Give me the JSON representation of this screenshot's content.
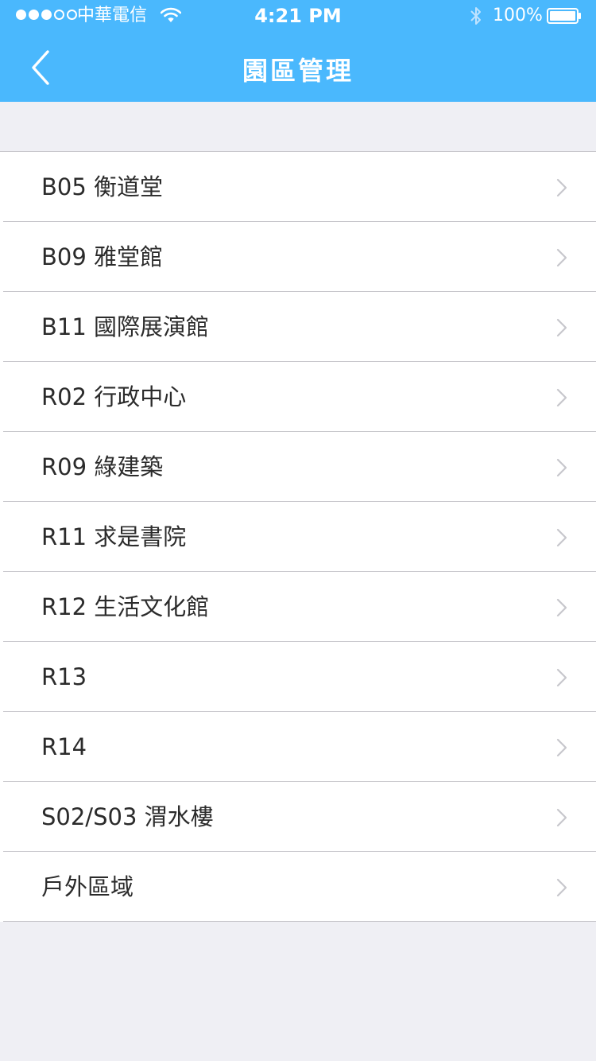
{
  "status_bar": {
    "carrier": "中華電信",
    "time": "4:21 PM",
    "battery": "100%",
    "signal_bars_filled": 3,
    "signal_bars_total": 5,
    "icons": [
      "wifi-icon",
      "bluetooth-icon",
      "battery-icon"
    ]
  },
  "nav": {
    "title": "園區管理",
    "back_icon": "chevron-left-icon"
  },
  "list": {
    "items": [
      {
        "label": "B05 衡道堂"
      },
      {
        "label": "B09 雅堂館"
      },
      {
        "label": "B11 國際展演館"
      },
      {
        "label": "R02 行政中心"
      },
      {
        "label": "R09 綠建築"
      },
      {
        "label": "R11 求是書院"
      },
      {
        "label": "R12 生活文化館"
      },
      {
        "label": "R13"
      },
      {
        "label": "R14"
      },
      {
        "label": "S02/S03 渭水樓"
      },
      {
        "label": "戶外區域"
      }
    ],
    "row_icon": "chevron-right-icon"
  },
  "colors": {
    "accent": "#4ab8fd",
    "background": "#efeff4",
    "row_background": "#ffffff",
    "separator": "#c8c7cc",
    "text": "#2b2b2b",
    "chevron": "#c7c7cc"
  }
}
